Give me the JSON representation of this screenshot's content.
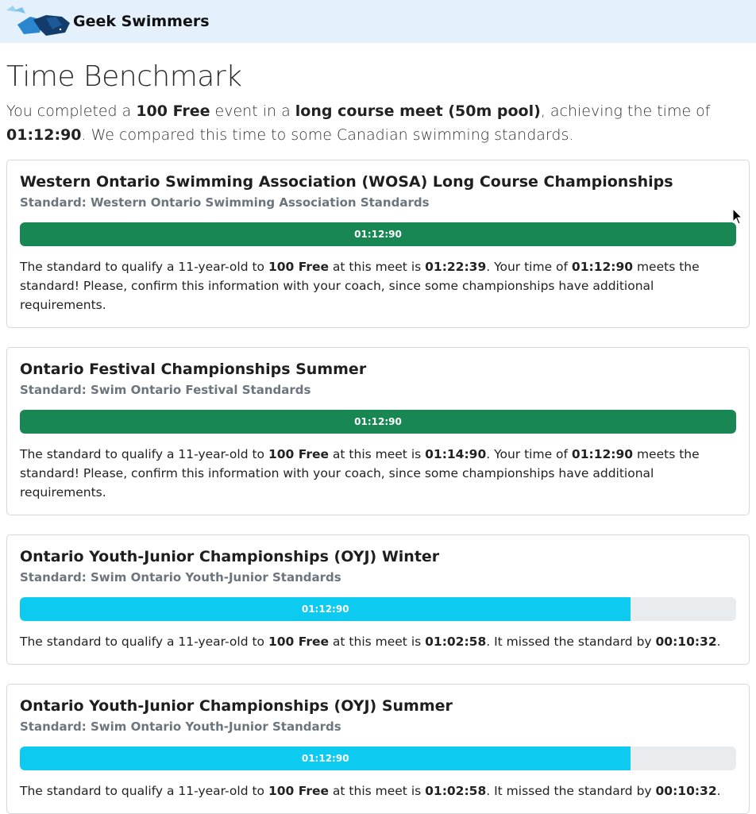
{
  "app": {
    "brand_name": "Geek Swimmers"
  },
  "page": {
    "title": "Time Benchmark",
    "intro": {
      "p1": "You completed a ",
      "event": "100 Free",
      "p2": " event in a ",
      "course": "long course meet (50m pool)",
      "p3": ", achieving the time of ",
      "time": "01:12:90",
      "p4": ". We compared this time to some Canadian swimming standards."
    }
  },
  "colors": {
    "success": "#198754",
    "info": "#0dcaf0",
    "track": "#e9ecef"
  },
  "cards": [
    {
      "title": "Western Ontario Swimming Association (WOSA) Long Course Championships",
      "subtitle": "Standard: Western Ontario Swimming Association Standards",
      "bar_label": "01:12:90",
      "progress": 1.0,
      "status": "success",
      "t1": "The standard to qualify a 11-year-old to ",
      "event": "100 Free",
      "t2": " at this meet is ",
      "standard_time": "01:22:39",
      "t3": ". Your time of ",
      "your_time": "01:12:90",
      "t4": " meets the standard! Please, confirm this information with your coach, since some championships have additional requirements."
    },
    {
      "title": "Ontario Festival Championships Summer",
      "subtitle": "Standard: Swim Ontario Festival Standards",
      "bar_label": "01:12:90",
      "progress": 1.0,
      "status": "success",
      "t1": "The standard to qualify a 11-year-old to ",
      "event": "100 Free",
      "t2": " at this meet is ",
      "standard_time": "01:14:90",
      "t3": ". Your time of ",
      "your_time": "01:12:90",
      "t4": " meets the standard! Please, confirm this information with your coach, since some championships have additional requirements."
    },
    {
      "title": "Ontario Youth-Junior Championships (OYJ) Winter",
      "subtitle": "Standard: Swim Ontario Youth-Junior Standards",
      "bar_label": "01:12:90",
      "progress": 0.853,
      "status": "info",
      "t1": "The standard to qualify a 11-year-old to ",
      "event": "100 Free",
      "t2": " at this meet is ",
      "standard_time": "01:02:58",
      "t3": ". It missed the standard by ",
      "your_time": "00:10:32",
      "t4": "."
    },
    {
      "title": "Ontario Youth-Junior Championships (OYJ) Summer",
      "subtitle": "Standard: Swim Ontario Youth-Junior Standards",
      "bar_label": "01:12:90",
      "progress": 0.853,
      "status": "info",
      "t1": "The standard to qualify a 11-year-old to ",
      "event": "100 Free",
      "t2": " at this meet is ",
      "standard_time": "01:02:58",
      "t3": ". It missed the standard by ",
      "your_time": "00:10:32",
      "t4": "."
    }
  ]
}
